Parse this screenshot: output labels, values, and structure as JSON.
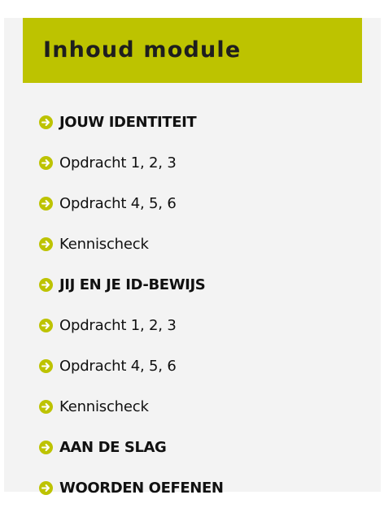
{
  "header": {
    "title": "Inhoud module"
  },
  "colors": {
    "accent": "#bdc300",
    "panel_bg": "#f3f3f3",
    "text": "#111111"
  },
  "nav": {
    "items": [
      {
        "label": "JOUW IDENTITEIT",
        "type": "section",
        "icon": "arrow-circle-right-icon"
      },
      {
        "label": "Opdracht 1, 2, 3",
        "type": "page",
        "icon": "arrow-circle-right-icon"
      },
      {
        "label": "Opdracht 4, 5, 6",
        "type": "page",
        "icon": "arrow-circle-right-icon"
      },
      {
        "label": "Kennischeck",
        "type": "page",
        "icon": "arrow-circle-right-icon"
      },
      {
        "label": "JIJ EN JE ID-BEWIJS",
        "type": "section",
        "icon": "arrow-circle-right-icon"
      },
      {
        "label": "Opdracht 1, 2, 3",
        "type": "page",
        "icon": "arrow-circle-right-icon"
      },
      {
        "label": "Opdracht 4, 5, 6",
        "type": "page",
        "icon": "arrow-circle-right-icon"
      },
      {
        "label": "Kennischeck",
        "type": "page",
        "icon": "arrow-circle-right-icon"
      },
      {
        "label": "AAN DE SLAG",
        "type": "section",
        "icon": "arrow-circle-right-icon"
      },
      {
        "label": "WOORDEN OEFENEN",
        "type": "section",
        "icon": "arrow-circle-right-icon"
      }
    ]
  }
}
